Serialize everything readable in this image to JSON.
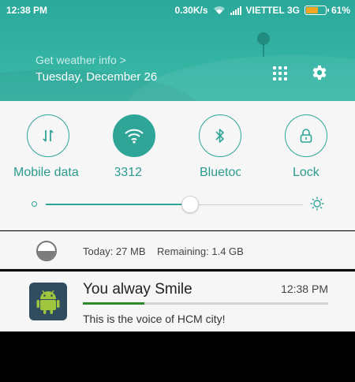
{
  "status_bar": {
    "time": "12:38 PM",
    "net_speed": "0.30K/s",
    "carrier": "VIETTEL 3G",
    "battery_percent_text": "61%",
    "battery_level": 0.61,
    "battery_color": "#f6a623"
  },
  "header": {
    "weather_link": "Get weather info >",
    "date": "Tuesday, December 26",
    "accent": "#2ba89a"
  },
  "quick_settings": {
    "toggles": [
      {
        "label": "Mobile data",
        "icon": "mobile-data-icon",
        "active": false
      },
      {
        "label": "3312",
        "icon": "wifi-icon",
        "active": true
      },
      {
        "label": "Bluetooth",
        "icon": "bluetooth-icon",
        "active": false
      },
      {
        "label": "Lock",
        "icon": "lock-icon",
        "active": false
      }
    ],
    "brightness_level": 0.56
  },
  "data_usage": {
    "today": "Today: 27 MB",
    "remaining": "Remaining: 1.4 GB"
  },
  "notification": {
    "title": "You alway Smile",
    "time": "12:38 PM",
    "body": "This is the voice of HCM city!",
    "progress": 0.25,
    "app_icon": "android-icon"
  }
}
